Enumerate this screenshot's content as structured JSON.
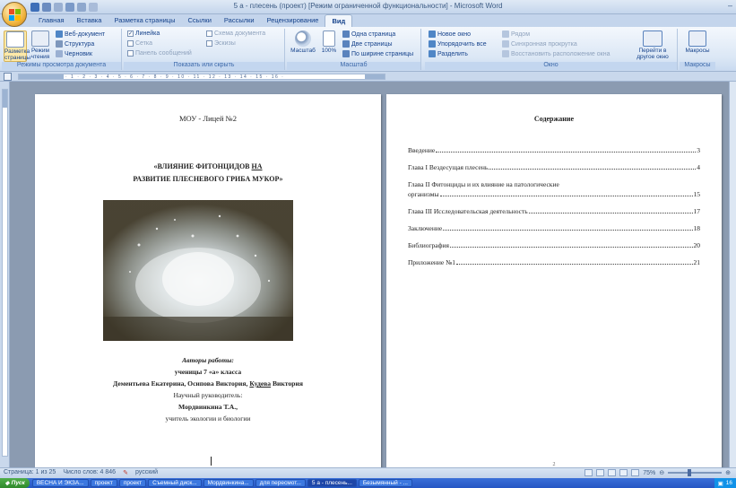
{
  "window": {
    "title": "5 а - плесень (проект) [Режим ограниченной функциональности] - Microsoft Word"
  },
  "ribbon": {
    "tabs": [
      {
        "label": "Главная",
        "active": false
      },
      {
        "label": "Вставка",
        "active": false
      },
      {
        "label": "Разметка страницы",
        "active": false
      },
      {
        "label": "Ссылки",
        "active": false
      },
      {
        "label": "Рассылки",
        "active": false
      },
      {
        "label": "Рецензирование",
        "active": false
      },
      {
        "label": "Вид",
        "active": true
      }
    ],
    "groups": {
      "views": {
        "label": "Режимы просмотра документа",
        "layout_btn": "Разметка страницы",
        "reading_btn": "Режим чтения",
        "web": "Веб-документ",
        "outline": "Структура",
        "draft": "Черновик"
      },
      "show": {
        "label": "Показать или скрыть",
        "ruler": "Линейка",
        "grid": "Сетка",
        "msgbar": "Панель сообщений",
        "docmap": "Схема документа",
        "thumbs": "Эскизы"
      },
      "zoom": {
        "label": "Масштаб",
        "zoom_btn": "Масштаб",
        "hundred": "100%",
        "one_page": "Одна страница",
        "two_pages": "Две страницы",
        "page_width": "По ширине страницы"
      },
      "window": {
        "label": "Окно",
        "new_window": "Новое окно",
        "arrange_all": "Упорядочить все",
        "split": "Разделить",
        "side_by_side": "Рядом",
        "sync_scroll": "Синхронная прокрутка",
        "reset_pos": "Восстановить расположение окна",
        "switch_window": "Перейти в другое окно"
      },
      "macros": {
        "label": "Макросы",
        "btn": "Макросы"
      }
    }
  },
  "page1": {
    "school": "МОУ - Лицей №2",
    "title_line1_prefix": "«ВЛИЯНИЕ ФИТОНЦИДОВ ",
    "title_line1_underlined": "НА",
    "title_line2": "РАЗВИТИЕ ПЛЕСНЕВОГО ГРИБА МУКОР»",
    "authors_heading": "Авторы работы:",
    "class_line": "ученицы 7 «а» класса",
    "names_prefix": "Дементьева Екатерина, Осипова Виктория, ",
    "names_underlined": "Кудева",
    "names_suffix": " Виктория",
    "supervisor_label": "Научный руководитель:",
    "supervisor_name": "Мордвинкина Т.А.,",
    "supervisor_role": "учитель экологии и биологии"
  },
  "page2": {
    "toc_title": "Содержание",
    "toc": [
      {
        "label": "Введение",
        "page": "3"
      },
      {
        "label": "Глава I  Вездесущая плесень",
        "page": "4"
      },
      {
        "label": "Глава  II   Фитонциды   и   их   влияние   на   патологические",
        "label2": "организмы",
        "page": "15",
        "wide": true
      },
      {
        "label": "Глава III Исследовательская деятельность",
        "page": "17"
      },
      {
        "label": "Заключение",
        "page": "18"
      },
      {
        "label": "Библиография",
        "page": "20"
      },
      {
        "label": "Приложение №1",
        "page": "21"
      }
    ],
    "page_number": "2"
  },
  "status": {
    "page": "Страница: 1 из 25",
    "words": "Число слов: 4 846",
    "language": "русский",
    "zoom": "75%"
  },
  "taskbar": {
    "start": "Пуск",
    "items": [
      {
        "label": "ВЕСНА И ЭКЗА...",
        "active": false
      },
      {
        "label": "проект",
        "active": false
      },
      {
        "label": "проект",
        "active": false
      },
      {
        "label": "Съемный диск...",
        "active": false
      },
      {
        "label": "Мордвинкина...",
        "active": false
      },
      {
        "label": "для пересмот...",
        "active": false
      },
      {
        "label": "5 а - плесень...",
        "active": true
      },
      {
        "label": "Безымянный - ...",
        "active": false
      }
    ],
    "clock": "16"
  },
  "colors": {
    "ribbon_bg": "#dbe7f5",
    "ribbon_text": "#15428b",
    "taskbar": "#2556c4",
    "start": "#2f8a2c"
  }
}
